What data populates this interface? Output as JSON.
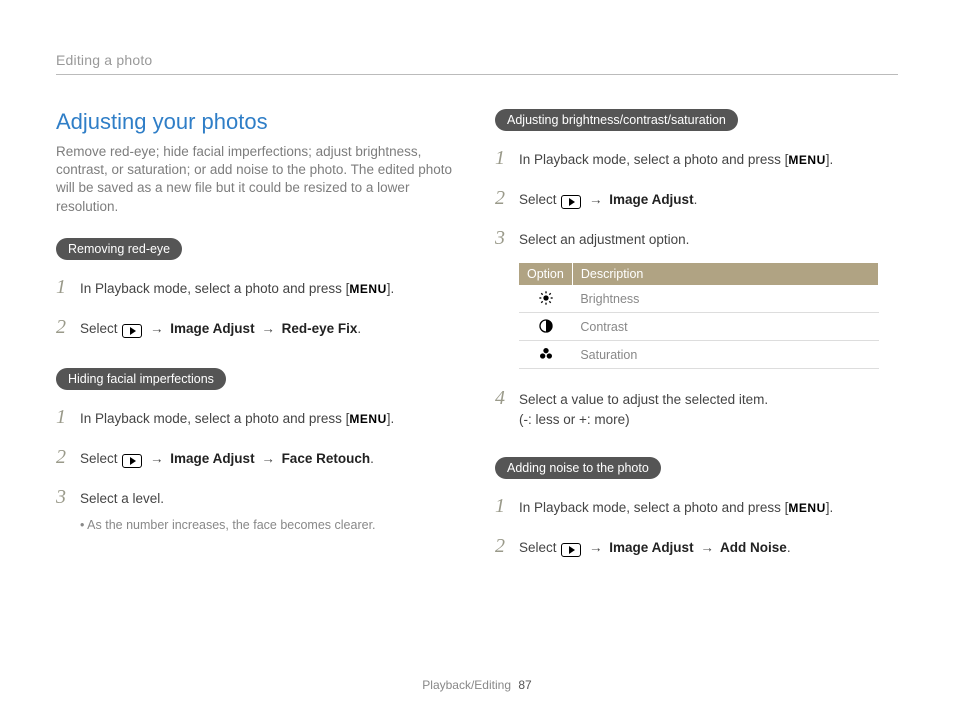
{
  "breadcrumb": "Editing a photo",
  "section_title": "Adjusting your photos",
  "intro": "Remove red-eye; hide facial imperfections; adjust brightness, contrast, or saturation; or add noise to the photo. The edited photo will be saved as a new file but it could be resized to a lower resolution.",
  "menu_label": "MENU",
  "arrow": "→",
  "left": {
    "group1": {
      "heading": "Removing red-eye",
      "step1_pre": "In Playback mode, select a photo and press [",
      "step1_post": "].",
      "step2_pre": "Select ",
      "step2_mid1": " Image Adjust ",
      "step2_mid2": " Red-eye Fix",
      "step2_end": "."
    },
    "group2": {
      "heading": "Hiding facial imperfections",
      "step1_pre": "In Playback mode, select a photo and press [",
      "step1_post": "].",
      "step2_pre": "Select ",
      "step2_mid1": " Image Adjust ",
      "step2_mid2": " Face Retouch",
      "step2_end": ".",
      "step3": "Select a level.",
      "bullet": "As the number increases, the face becomes clearer."
    }
  },
  "right": {
    "group1": {
      "heading": "Adjusting brightness/contrast/saturation",
      "step1_pre": "In Playback mode, select a photo and press [",
      "step1_post": "].",
      "step2_pre": "Select ",
      "step2_mid1": " Image Adjust",
      "step2_end": ".",
      "step3": "Select an adjustment option.",
      "table": {
        "h1": "Option",
        "h2": "Description",
        "rows": [
          {
            "icon": "brightness",
            "desc": "Brightness"
          },
          {
            "icon": "contrast",
            "desc": "Contrast"
          },
          {
            "icon": "saturation",
            "desc": "Saturation"
          }
        ]
      },
      "step4a": "Select a value to adjust the selected item.",
      "step4b": "(-: less or +: more)"
    },
    "group2": {
      "heading": "Adding noise to the photo",
      "step1_pre": "In Playback mode, select a photo and press [",
      "step1_post": "].",
      "step2_pre": "Select ",
      "step2_mid1": " Image Adjust ",
      "step2_mid2": " Add Noise",
      "step2_end": "."
    }
  },
  "footer": {
    "section": "Playback/Editing",
    "page": "87"
  }
}
